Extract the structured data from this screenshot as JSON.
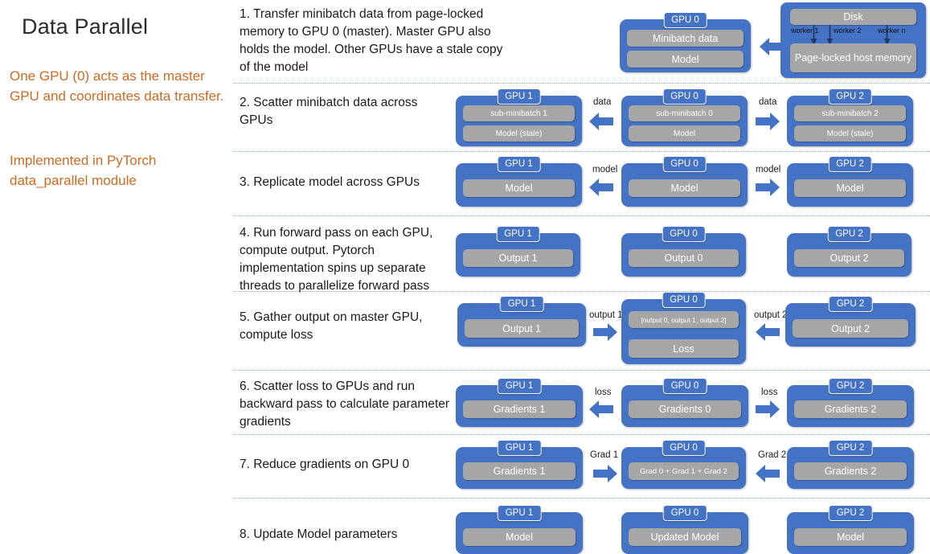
{
  "title": "Data Parallel",
  "notes": [
    "One GPU (0) acts as the master GPU and coordinates data transfer.",
    "Implemented in PyTorch data_parallel module"
  ],
  "colors": {
    "gpu_blue": "#4472C4",
    "slab_gray": "#A6A6A6",
    "note_orange": "#D2691E",
    "separator": "#8FAADC"
  },
  "host_group": {
    "disk": "Disk",
    "memory": "Page-locked host memory",
    "workers": [
      "worker 1",
      "worker 2",
      "worker n"
    ]
  },
  "steps": [
    {
      "id": "step-1",
      "text": "1. Transfer minibatch data from page-locked memory  to GPU 0 (master). Master GPU also holds the model. Other GPUs have a stale copy of the model",
      "gpus": [
        {
          "label": "GPU 0",
          "slabs": [
            "Minibatch data",
            "Model"
          ]
        }
      ],
      "arrows": [
        {
          "dir": "left",
          "label": ""
        }
      ]
    },
    {
      "id": "step-2",
      "text": "2. Scatter minibatch data across GPUs",
      "gpus": [
        {
          "label": "GPU 1",
          "slabs": [
            "sub-minibatch 1",
            "Model (stale)"
          ]
        },
        {
          "label": "GPU 0",
          "slabs": [
            "sub-minibatch 0",
            "Model"
          ]
        },
        {
          "label": "GPU 2",
          "slabs": [
            "sub-minibatch 2",
            "Model (stale)"
          ]
        }
      ],
      "arrows": [
        {
          "dir": "left",
          "label": "data"
        },
        {
          "dir": "right",
          "label": "data"
        }
      ]
    },
    {
      "id": "step-3",
      "text": "3. Replicate model across GPUs",
      "gpus": [
        {
          "label": "GPU 1",
          "slabs": [
            "Model"
          ]
        },
        {
          "label": "GPU 0",
          "slabs": [
            "Model"
          ]
        },
        {
          "label": "GPU 2",
          "slabs": [
            "Model"
          ]
        }
      ],
      "arrows": [
        {
          "dir": "left",
          "label": "model"
        },
        {
          "dir": "right",
          "label": "model"
        }
      ]
    },
    {
      "id": "step-4",
      "text": "4. Run forward pass on each GPU, compute output. Pytorch implementation spins up separate threads to parallelize forward pass",
      "gpus": [
        {
          "label": "GPU 1",
          "slabs": [
            "Output 1"
          ]
        },
        {
          "label": "GPU 0",
          "slabs": [
            "Output 0"
          ]
        },
        {
          "label": "GPU 2",
          "slabs": [
            "Output 2"
          ]
        }
      ],
      "arrows": []
    },
    {
      "id": "step-5",
      "text": "5. Gather output on master GPU, compute loss",
      "gpus": [
        {
          "label": "GPU 1",
          "slabs": [
            "Output 1"
          ]
        },
        {
          "label": "GPU 0",
          "slabs": [
            "[output 0, output 1, output 2]",
            "Loss"
          ]
        },
        {
          "label": "GPU 2",
          "slabs": [
            "Output  2"
          ]
        }
      ],
      "arrows": [
        {
          "dir": "right",
          "label": "output 1"
        },
        {
          "dir": "left",
          "label": "output 2"
        }
      ]
    },
    {
      "id": "step-6",
      "text": "6. Scatter loss to GPUs and run backward pass to calculate parameter gradients",
      "gpus": [
        {
          "label": "GPU 1",
          "slabs": [
            "Gradients 1"
          ]
        },
        {
          "label": "GPU 0",
          "slabs": [
            "Gradients 0"
          ]
        },
        {
          "label": "GPU 2",
          "slabs": [
            "Gradients 2"
          ]
        }
      ],
      "arrows": [
        {
          "dir": "left",
          "label": "loss"
        },
        {
          "dir": "right",
          "label": "loss"
        }
      ]
    },
    {
      "id": "step-7",
      "text": "7. Reduce gradients on GPU 0",
      "gpus": [
        {
          "label": "GPU 1",
          "slabs": [
            "Gradients 1"
          ]
        },
        {
          "label": "GPU 0",
          "slabs": [
            "Grad 0 + Grad 1 + Grad 2"
          ]
        },
        {
          "label": "GPU 2",
          "slabs": [
            "Gradients 2"
          ]
        }
      ],
      "arrows": [
        {
          "dir": "right",
          "label": "Grad 1"
        },
        {
          "dir": "left",
          "label": "Grad 2"
        }
      ]
    },
    {
      "id": "step-8",
      "text": "8. Update Model parameters",
      "gpus": [
        {
          "label": "GPU 1",
          "slabs": [
            "Model"
          ]
        },
        {
          "label": "GPU 0",
          "slabs": [
            "Updated Model"
          ]
        },
        {
          "label": "GPU 2",
          "slabs": [
            "Model"
          ]
        }
      ],
      "arrows": []
    }
  ]
}
